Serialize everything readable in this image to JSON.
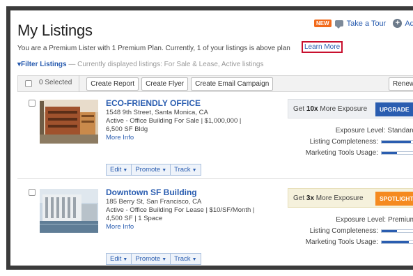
{
  "header": {
    "title": "My Listings",
    "new_badge": "NEW",
    "tour_label": "Take a Tour",
    "add_label": "Ad"
  },
  "premium_notice": {
    "text": "You are a Premium Lister with 1 Premium Plan. Currently, 1 of your listings is above plan",
    "learn_more": "Learn More"
  },
  "filter": {
    "label": "Filter Listings",
    "description": "— Currently displayed listings: For Sale & Lease, Active listings"
  },
  "toolbar": {
    "selected": "0 Selected",
    "create_report": "Create Report",
    "create_flyer": "Create Flyer",
    "create_email_campaign": "Create Email Campaign",
    "renew": "Renew"
  },
  "listings": [
    {
      "title": "ECO-FRIENDLY OFFICE",
      "address": "1548 9th Street, Santa Monica, CA",
      "status_line": "Active - Office Building For Sale | $1,000,000 |",
      "size_line": "6,500 SF Bldg",
      "more_info": "More Info",
      "edit": "Edit",
      "promote": "Promote",
      "track": "Track",
      "exposure_prefix": "Get ",
      "exposure_multiplier": "10x",
      "exposure_suffix": " More Exposure",
      "cta": "UPGRADE",
      "exposure_level_label": "Exposure Level:",
      "exposure_level": "Standard",
      "completeness_label": "Listing Completeness:",
      "completeness_fraction": 0.88,
      "tools_label": "Marketing Tools Usage:",
      "tools_fraction": 0.45
    },
    {
      "title": "Downtown SF Building",
      "address": "185 Berry St, San Francisco, CA",
      "status_line": "Active - Office Building For Lease | $10/SF/Month |",
      "size_line": "4,500 SF | 1 Space",
      "more_info": "More Info",
      "edit": "Edit",
      "promote": "Promote",
      "track": "Track",
      "exposure_prefix": "Get ",
      "exposure_multiplier": "3x",
      "exposure_suffix": " More Exposure",
      "cta": "SPOTLIGHT",
      "exposure_level_label": "Exposure Level:",
      "exposure_level": "Premium",
      "completeness_label": "Listing Completeness:",
      "completeness_fraction": 0.45,
      "tools_label": "Marketing Tools Usage:",
      "tools_fraction": 0.82
    }
  ],
  "icons": {
    "tour": "chat-bubble-icon",
    "add": "plus-circle-icon",
    "filter": "triangle-down-icon",
    "caret": "caret-down-icon"
  },
  "colors": {
    "link": "#2a5db0",
    "new_badge": "#f26a1b",
    "learn_more_outline": "#c8102e",
    "upgrade": "#2a5db0",
    "spotlight": "#f58a1f"
  }
}
